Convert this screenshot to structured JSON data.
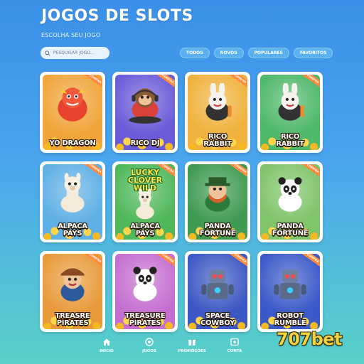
{
  "header": {
    "title": "JOGOS DE SLOTS",
    "subtitle": "ESCOLHA SEU JOGO"
  },
  "search": {
    "placeholder": "PESQUISAR JOGO..."
  },
  "filters": [
    "TODOS",
    "NOVOS",
    "POPULARES",
    "FAVORITOS"
  ],
  "badge_text": "COMPRA",
  "games": [
    {
      "name": "YO DRAGON",
      "bg": "#f0a53a",
      "hero": "dragon-icon"
    },
    {
      "name": "RICO DJ",
      "bg": "#6b5bd8",
      "hero": "monkey-icon"
    },
    {
      "name": "RICO RABBIT",
      "bg": "#f0b23c",
      "hero": "rabbit-icon"
    },
    {
      "name": "RICO RABBIT",
      "bg": "#4fb86a",
      "hero": "rabbit-icon"
    },
    {
      "name": "ALPACA PAYS",
      "bg": "#5fb0e6",
      "hero": "alpaca-icon"
    },
    {
      "name": "ALPACA PAYS",
      "bg": "#4fb85a",
      "hero": "alpaca-icon",
      "logo": "LUCKY CLOVER WILD"
    },
    {
      "name": "PANDA FORTUNE",
      "bg": "#3f9a52",
      "hero": "leprechaun-icon"
    },
    {
      "name": "PANDA FORTUNE",
      "bg": "#7fc46a",
      "hero": "panda-icon"
    },
    {
      "name": "TREASRE PIRATES",
      "bg": "#e89a3a",
      "hero": "pirate-icon"
    },
    {
      "name": "TREASURE PIRATES",
      "bg": "#c56fd0",
      "hero": "panda-icon"
    },
    {
      "name": "SPACE COWBOY",
      "bg": "#3d58c4",
      "hero": "robot-icon"
    },
    {
      "name": "ROBOT RUMBLE",
      "bg": "#3a5ac9",
      "hero": "robot-icon"
    }
  ],
  "nav": [
    {
      "label": "INÍCIO",
      "icon": "home-icon"
    },
    {
      "label": "JOGOS",
      "icon": "games-icon"
    },
    {
      "label": "PROMOÇÕES",
      "icon": "gift-icon"
    },
    {
      "label": "CONTA",
      "icon": "account-icon"
    }
  ],
  "brand": "707bet"
}
